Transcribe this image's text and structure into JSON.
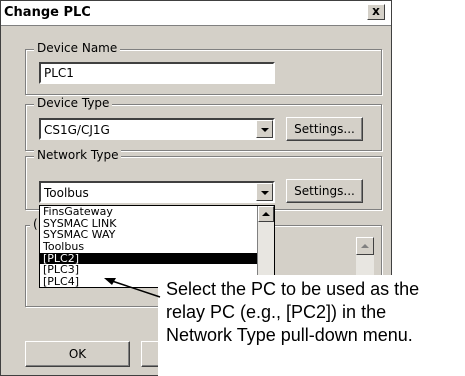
{
  "dialog": {
    "title": "Change PLC",
    "close_label": "x"
  },
  "device_name": {
    "legend": "Device Name",
    "value": "PLC1"
  },
  "device_type": {
    "legend": "Device Type",
    "value": "CS1G/CJ1G",
    "settings_label": "Settings..."
  },
  "network_type": {
    "legend": "Network Type",
    "value": "Toolbus",
    "settings_label": "Settings..."
  },
  "hidden_group": {
    "legend_fragment": "("
  },
  "dropdown": {
    "items": [
      "FinsGateway",
      "SYSMAC LINK",
      "SYSMAC WAY",
      "Toolbus",
      "[PLC2]",
      "[PLC3]",
      "[PLC4]"
    ],
    "selected": "[PLC2]"
  },
  "buttons": {
    "ok_label": "OK"
  },
  "callout": {
    "lines": [
      "Select the PC to be used as the",
      "relay PC (e.g., [PC2]) in the",
      "Network Type pull-down menu."
    ]
  },
  "colors": {
    "dialog_bg": "#d4d0c8",
    "selection_bg": "#000000",
    "selection_fg": "#ffffff"
  }
}
